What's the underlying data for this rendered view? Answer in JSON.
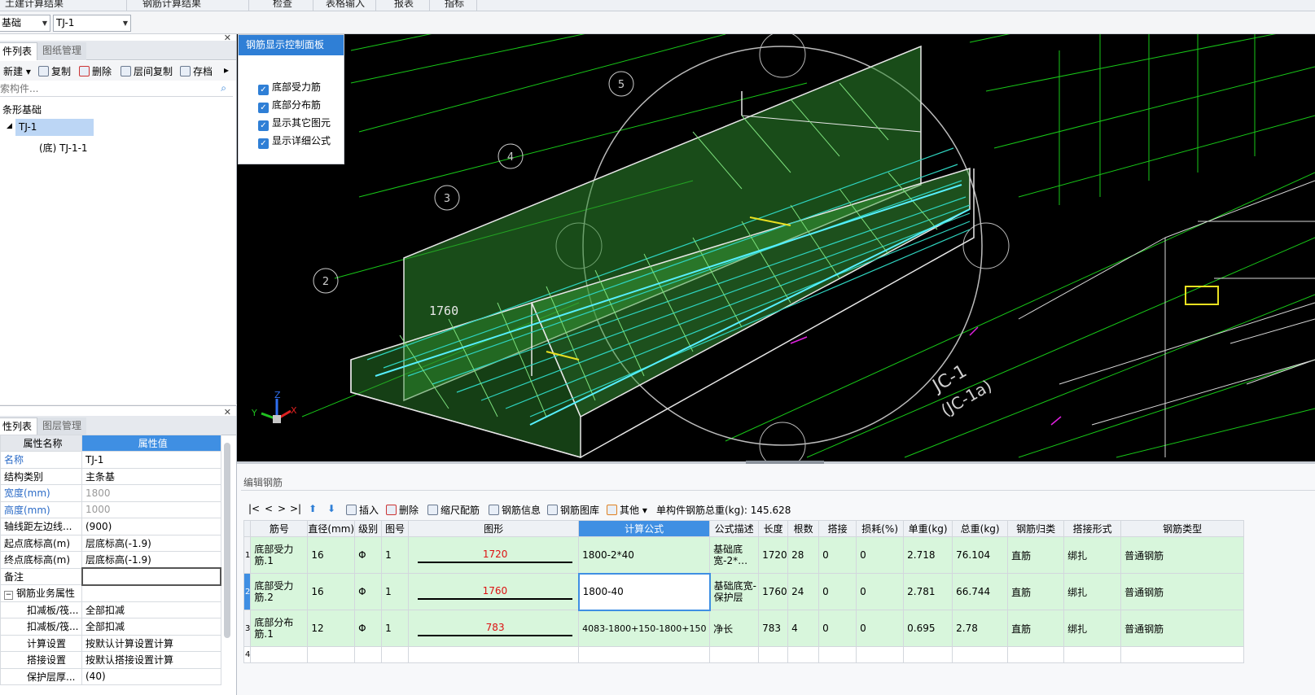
{
  "top_menu": [
    "土建计算结果",
    "钢筋计算结果",
    "检查",
    "表格输入",
    "报表",
    "指标"
  ],
  "selectors": {
    "type": "基础",
    "component": "TJ-1"
  },
  "component_panel": {
    "tabs": [
      "件列表",
      "图纸管理"
    ],
    "toolbar": [
      "新建",
      "复制",
      "删除",
      "层间复制",
      "存档"
    ],
    "search_placeholder": "索构件...",
    "tree": [
      "条形基础",
      "TJ-1",
      "(底) TJ-1-1"
    ]
  },
  "property_panel": {
    "tabs": [
      "性列表",
      "图层管理"
    ],
    "headers": [
      "属性名称",
      "属性值"
    ],
    "rows": [
      {
        "name": "名称",
        "value": "TJ-1"
      },
      {
        "name": "结构类别",
        "value": "主条基"
      },
      {
        "name": "宽度(mm)",
        "value": "1800"
      },
      {
        "name": "高度(mm)",
        "value": "1000"
      },
      {
        "name": "轴线距左边线...",
        "value": "(900)"
      },
      {
        "name": "起点底标高(m)",
        "value": "层底标高(-1.9)"
      },
      {
        "name": "终点底标高(m)",
        "value": "层底标高(-1.9)"
      },
      {
        "name": "备注",
        "value": ""
      },
      {
        "name": "钢筋业务属性",
        "value": ""
      },
      {
        "name": "扣减板/筏...",
        "value": "全部扣减"
      },
      {
        "name": "扣减板/筏...",
        "value": "全部扣减"
      },
      {
        "name": "计算设置",
        "value": "按默认计算设置计算"
      },
      {
        "name": "搭接设置",
        "value": "按默认搭接设置计算"
      },
      {
        "name": "保护层厚...",
        "value": "(40)"
      }
    ]
  },
  "control_panel": {
    "title": "钢筋显示控制面板",
    "options": [
      "底部受力筋",
      "底部分布筋",
      "显示其它图元",
      "显示详细公式"
    ]
  },
  "viewport": {
    "dimension_label": "1760",
    "axis_labels": [
      "X",
      "Y",
      "Z"
    ],
    "grid_markers": [
      "5",
      "4",
      "3",
      "2"
    ],
    "section_label": "JC-1",
    "section_sub": "(JC-1a)"
  },
  "editor": {
    "title": "编辑钢筋",
    "nav": [
      "|<",
      "<",
      ">",
      ">|"
    ],
    "toolbar": [
      "插入",
      "删除",
      "缩尺配筋",
      "钢筋信息",
      "钢筋图库",
      "其他"
    ],
    "total_weight": "单构件钢筋总重(kg): 145.628",
    "columns": [
      "筋号",
      "直径(mm)",
      "级别",
      "图号",
      "图形",
      "计算公式",
      "公式描述",
      "长度",
      "根数",
      "搭接",
      "损耗(%)",
      "单重(kg)",
      "总重(kg)",
      "钢筋归类",
      "搭接形式",
      "钢筋类型"
    ],
    "rows": [
      {
        "num": "1",
        "name": "底部受力筋.1",
        "dia": "16",
        "grade": "Φ",
        "fig": "1",
        "shape": "1720",
        "formula": "1800-2*40",
        "desc": "基础底宽-2*…",
        "len": "1720",
        "count": "28",
        "lap": "0",
        "loss": "0",
        "unit": "2.718",
        "total": "76.104",
        "cat": "直筋",
        "lapform": "绑扎",
        "type": "普通钢筋"
      },
      {
        "num": "2",
        "name": "底部受力筋.2",
        "dia": "16",
        "grade": "Φ",
        "fig": "1",
        "shape": "1760",
        "formula": "1800-40",
        "desc": "基础底宽-保护层",
        "len": "1760",
        "count": "24",
        "lap": "0",
        "loss": "0",
        "unit": "2.781",
        "total": "66.744",
        "cat": "直筋",
        "lapform": "绑扎",
        "type": "普通钢筋"
      },
      {
        "num": "3",
        "name": "底部分布筋.1",
        "dia": "12",
        "grade": "Φ",
        "fig": "1",
        "shape": "783",
        "formula": "4083-1800+150-1800+150",
        "desc": "净长",
        "len": "783",
        "count": "4",
        "lap": "0",
        "loss": "0",
        "unit": "0.695",
        "total": "2.78",
        "cat": "直筋",
        "lapform": "绑扎",
        "type": "普通钢筋"
      },
      {
        "num": "4"
      }
    ]
  }
}
